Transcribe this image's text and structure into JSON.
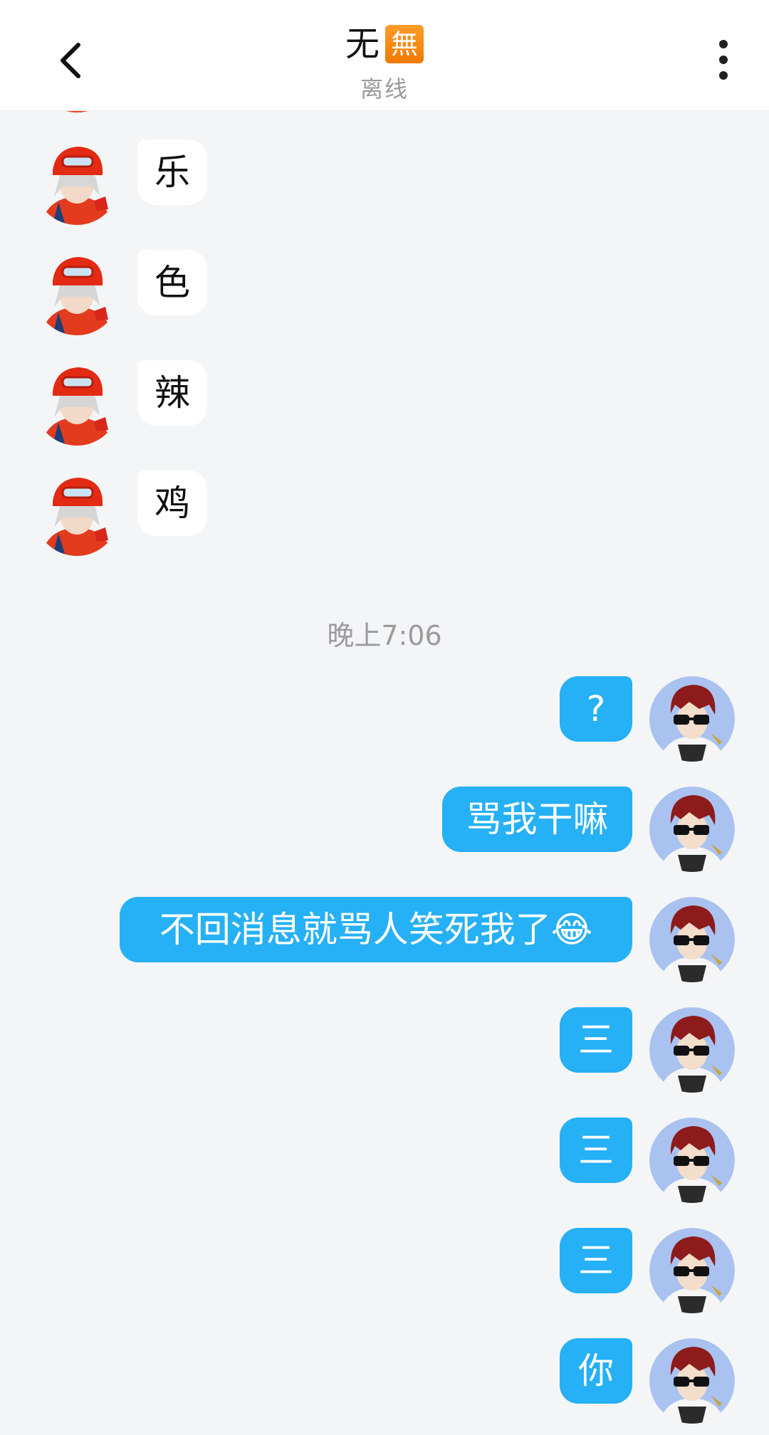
{
  "header": {
    "back_icon": "chevron-left-icon",
    "title": "无",
    "title_badge": "無",
    "subtitle": "离线",
    "more_icon": "vertical-dots-icon"
  },
  "messages_incoming": [
    {
      "text": "乐"
    },
    {
      "text": "色"
    },
    {
      "text": "辣"
    },
    {
      "text": "鸡"
    }
  ],
  "timestamp": "晚上7:06",
  "messages_outgoing": [
    {
      "text": "?"
    },
    {
      "text": "骂我干嘛"
    },
    {
      "text": "不回消息就骂人笑死我了😂"
    },
    {
      "text": "三"
    },
    {
      "text": "三"
    },
    {
      "text": "三"
    },
    {
      "text": "你"
    }
  ],
  "colors": {
    "outgoing_bubble": "#26b0f5",
    "incoming_bubble": "#ffffff",
    "background": "#f4f5f7",
    "badge": "#f07a00"
  }
}
